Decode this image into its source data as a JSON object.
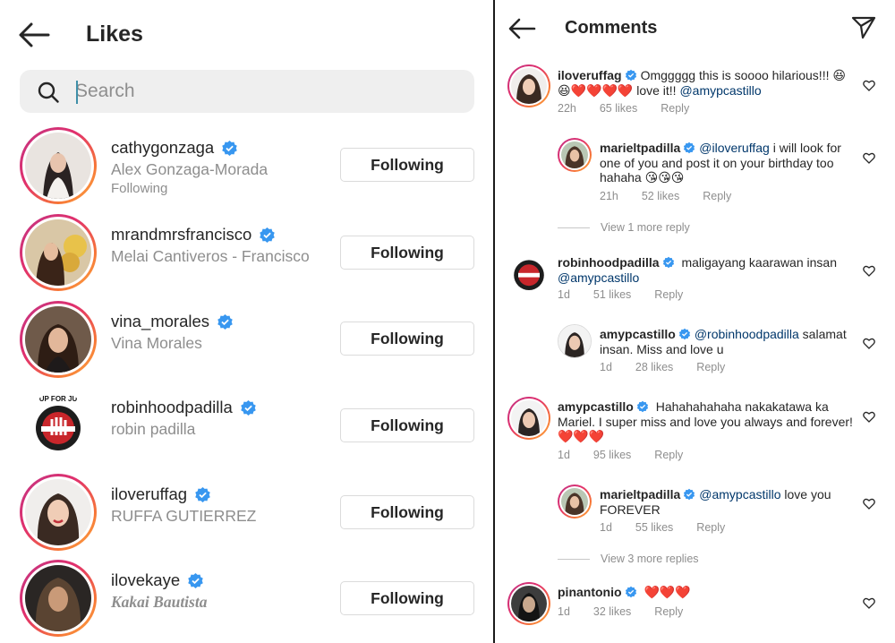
{
  "likes": {
    "title": "Likes",
    "search": {
      "placeholder": "Search",
      "value": ""
    },
    "users": [
      {
        "username": "cathygonzaga",
        "full_name": "Alex Gonzaga-Morada",
        "status": "Following",
        "button": "Following"
      },
      {
        "username": "mrandmrsfrancisco",
        "full_name": "Melai Cantiveros - Francisco",
        "button": "Following"
      },
      {
        "username": "vina_morales",
        "full_name": "Vina Morales",
        "button": "Following"
      },
      {
        "username": "robinhoodpadilla",
        "full_name": "robin padilla",
        "button": "Following"
      },
      {
        "username": "iloveruffag",
        "full_name": "RUFFA GUTIERREZ",
        "button": "Following"
      },
      {
        "username": "ilovekaye",
        "full_name": "Kakai Bautista",
        "button": "Following"
      }
    ]
  },
  "comments": {
    "title": "Comments",
    "items": [
      {
        "username": "iloveruffag",
        "text_before": "Omggggg this is soooo hilarious!!! 😆",
        "text_line2": "😆❤️❤️❤️❤️ love it!! ",
        "mention": "@amypcastillo",
        "time": "22h",
        "likes": "65 likes",
        "reply": "Reply"
      },
      {
        "username": "marieltpadilla",
        "mention": "@iloveruffag",
        "text": " i will look for one of you and post it on your birthday too hahaha 😘😘😘",
        "time": "21h",
        "likes": "52 likes",
        "reply": "Reply"
      },
      {
        "username": "robinhoodpadilla",
        "text": "maligayang kaarawan insan",
        "mention": "@amypcastillo",
        "time": "1d",
        "likes": "51 likes",
        "reply": "Reply"
      },
      {
        "username": "amypcastillo",
        "mention": "@robinhoodpadilla",
        "text": " salamat insan. Miss and love u",
        "time": "1d",
        "likes": "28 likes",
        "reply": "Reply"
      },
      {
        "username": "amypcastillo",
        "text": "Hahahahahaha nakakatawa ka Mariel. I super miss and love you always and forever! ❤️❤️❤️",
        "time": "1d",
        "likes": "95 likes",
        "reply": "Reply"
      },
      {
        "username": "marieltpadilla",
        "mention": "@amypcastillo",
        "text": " love you FOREVER",
        "time": "1d",
        "likes": "55 likes",
        "reply": "Reply"
      },
      {
        "username": "pinantonio",
        "text": "❤️❤️❤️",
        "time": "1d",
        "likes": "32 likes",
        "reply": "Reply"
      }
    ],
    "view_more_1": "View 1 more reply",
    "view_more_2": "View 3 more replies"
  },
  "colors": {
    "verified": "#3897f0",
    "heart": "#ed4956",
    "mention": "#00376b",
    "muted": "#8e8e8e"
  },
  "icons": [
    "back-arrow-icon",
    "search-icon",
    "verified-badge-icon",
    "send-icon",
    "heart-outline-icon"
  ]
}
